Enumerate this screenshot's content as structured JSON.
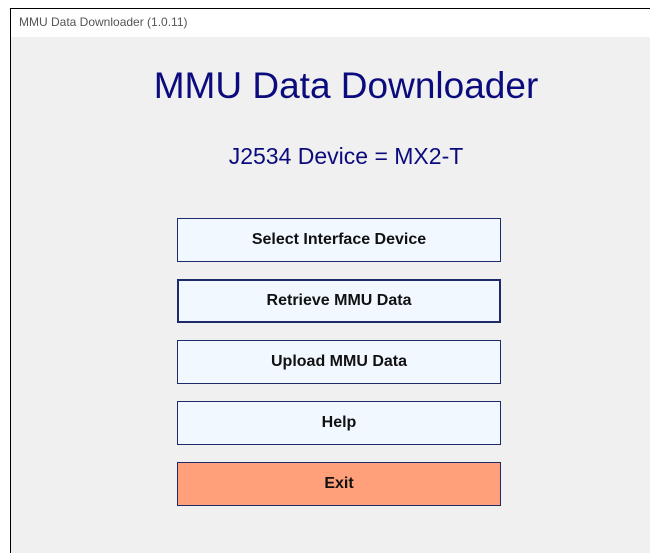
{
  "window": {
    "title": "MMU Data Downloader (1.0.11)"
  },
  "main": {
    "heading": "MMU Data Downloader",
    "device_status": "J2534 Device = MX2-T"
  },
  "buttons": {
    "select_interface": "Select Interface Device",
    "retrieve": "Retrieve MMU Data",
    "upload": "Upload MMU Data",
    "help": "Help",
    "exit": "Exit"
  },
  "colors": {
    "heading": "#0b0b7e",
    "button_bg": "#f1f8ff",
    "exit_bg": "#ffa07a",
    "window_bg": "#f0f0f0"
  }
}
